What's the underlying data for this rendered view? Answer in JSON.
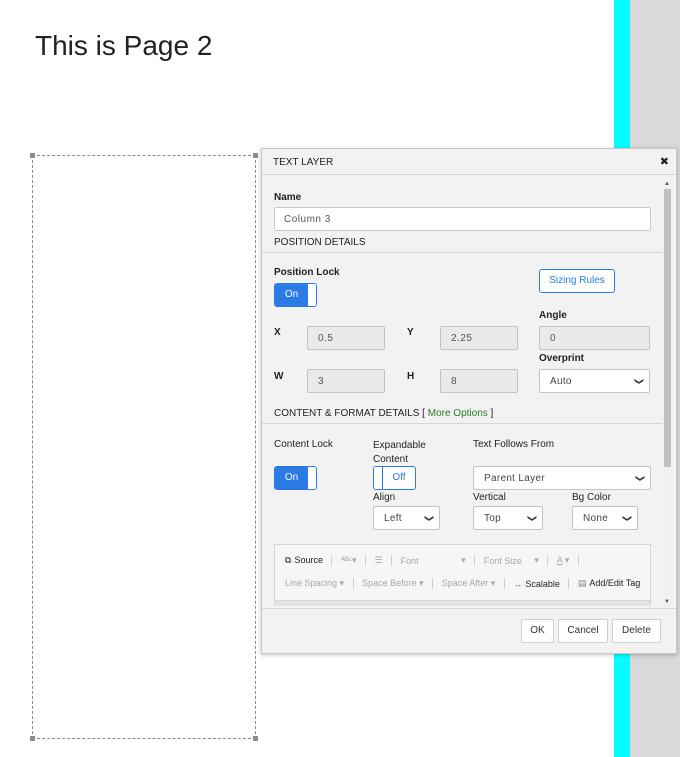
{
  "page": {
    "title": "This is Page 2",
    "colors": {
      "cyan_strip": "#00ffff",
      "gray_strip": "#d9d9d9",
      "accent": "#2c7be5",
      "more_options_link": "#2a7a2a"
    }
  },
  "dialog": {
    "title": "TEXT LAYER",
    "close_icon": "close-x-icon",
    "name_label": "Name",
    "name_value": "Column 3",
    "position_section": "POSITION DETAILS",
    "position_lock_label": "Position Lock",
    "position_lock_state": "On",
    "sizing_rules_label": "Sizing Rules",
    "angle_label": "Angle",
    "angle_value": "0",
    "x_label": "X",
    "x_value": "0.5",
    "y_label": "Y",
    "y_value": "2.25",
    "w_label": "W",
    "w_value": "3",
    "h_label": "H",
    "h_value": "8",
    "overprint_label": "Overprint",
    "overprint_value": "Auto",
    "content_section": "CONTENT & FORMAT DETAILS [",
    "more_options": "More Options",
    "content_section_end": "]",
    "content_lock_label": "Content Lock",
    "content_lock_state": "On",
    "expandable_label": "Expandable Content",
    "expandable_state": "Off",
    "text_follows_label": "Text Follows From",
    "text_follows_value": "Parent Layer",
    "align_label": "Align",
    "align_value": "Left",
    "vertical_label": "Vertical",
    "vertical_value": "Top",
    "bgcolor_label": "Bg Color",
    "bgcolor_value": "None",
    "toolbar": {
      "source": "Source",
      "font": "Font",
      "font_size": "Font Size",
      "font_color": "A",
      "line_spacing": "Line Spacing",
      "space_before": "Space Before",
      "space_after": "Space After",
      "scalable": "Scalable",
      "add_edit_tag": "Add/Edit Tag"
    },
    "buttons": {
      "ok": "OK",
      "cancel": "Cancel",
      "delete": "Delete"
    }
  }
}
